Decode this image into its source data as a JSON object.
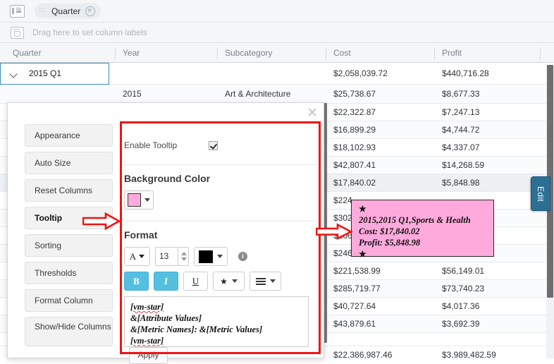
{
  "pivot": {
    "row_labels_icon": "row-labels-icon",
    "chip": {
      "label": "Quarter",
      "drag_handle": "drag-dots-icon",
      "remove": "remove-chip-icon"
    },
    "column_labels_placeholder": "Drag here to set column labels",
    "column_labels_icon": "drop-target-icon"
  },
  "columns": [
    {
      "label": "Quarter"
    },
    {
      "label": "Year"
    },
    {
      "label": "Subcategory"
    },
    {
      "label": "Cost"
    },
    {
      "label": "Profit"
    }
  ],
  "selected_cell": {
    "label": "2015 Q1",
    "expanded": true
  },
  "rows": [
    {
      "quarter": "",
      "year": "",
      "subcategory": "",
      "cost": "$2,058,039.72",
      "profit": "$440,716.28"
    },
    {
      "quarter": "",
      "year": "2015",
      "subcategory": "Art & Architecture",
      "cost": "$25,738.67",
      "profit": "$8,677.33"
    },
    {
      "quarter": "",
      "year": "",
      "subcategory": "",
      "cost": "$22,322.87",
      "profit": "$7,247.13"
    },
    {
      "quarter": "",
      "year": "",
      "subcategory": "",
      "cost": "$16,899.29",
      "profit": "$4,744.72"
    },
    {
      "quarter": "",
      "year": "",
      "subcategory": "",
      "cost": "$18,102.93",
      "profit": "$4,337.07"
    },
    {
      "quarter": "",
      "year": "",
      "subcategory": "",
      "cost": "$42,807.41",
      "profit": "$14,268.59"
    },
    {
      "quarter": "",
      "year": "",
      "subcategory": "",
      "cost": "$17,840.02",
      "profit": "$5,848.98"
    },
    {
      "quarter": "",
      "year": "",
      "subcategory": "",
      "cost": "$224",
      "profit": ""
    },
    {
      "quarter": "",
      "year": "",
      "subcategory": "",
      "cost": "$302",
      "profit": ""
    },
    {
      "quarter": "",
      "year": "",
      "subcategory": "",
      "cost": "$106",
      "profit": ""
    },
    {
      "quarter": "",
      "year": "",
      "subcategory": "",
      "cost": "$246",
      "profit": ""
    },
    {
      "quarter": "",
      "year": "",
      "subcategory": "",
      "cost": "$221,538.99",
      "profit": "$56,149.01"
    },
    {
      "quarter": "",
      "year": "",
      "subcategory": "",
      "cost": "$285,719.77",
      "profit": "$73,740.23"
    },
    {
      "quarter": "",
      "year": "",
      "subcategory": "",
      "cost": "$40,727.64",
      "profit": "$4,017.36"
    },
    {
      "quarter": "",
      "year": "",
      "subcategory": "",
      "cost": "$43,879.61",
      "profit": "$3,692.39"
    },
    {
      "quarter": "",
      "year": "",
      "subcategory": "",
      "cost": "",
      "profit": ""
    },
    {
      "quarter": "",
      "year": "",
      "subcategory": "",
      "cost": "$22,386,987.46",
      "profit": "$3,989,482.59"
    }
  ],
  "edit_tab": {
    "label": "Edit"
  },
  "dialog": {
    "close_label": "close",
    "menu": [
      {
        "label": "Appearance",
        "active": false
      },
      {
        "label": "Auto Size",
        "active": false
      },
      {
        "label": "Reset Columns",
        "active": false
      },
      {
        "label": "Tooltip",
        "active": true
      },
      {
        "label": "Sorting",
        "active": false
      },
      {
        "label": "Thresholds",
        "active": false
      },
      {
        "label": "Format Column",
        "active": false
      },
      {
        "label": "Show/Hide Columns",
        "active": false
      }
    ],
    "enable_tooltip": {
      "label": "Enable Tooltip",
      "checked": true
    },
    "background_color": {
      "title": "Background Color",
      "value": "#FFAADD"
    },
    "format": {
      "title": "Format",
      "font_button": "A",
      "font_size": "13",
      "text_color": "#000000",
      "info_label": "i",
      "bold": {
        "label": "B",
        "active": true
      },
      "italic": {
        "label": "I",
        "active": true
      },
      "underline": {
        "label": "U",
        "active": false
      },
      "symbol": {
        "label": "★",
        "active": false
      },
      "align": {
        "label": "align",
        "active": false
      },
      "text_lines": [
        "[vm-star]",
        "&[Attribute Values]",
        "&[Metric Names]: &[Metric Values]",
        "[vm-star]"
      ]
    },
    "apply_label": "Apply"
  },
  "tooltip_preview": {
    "star_top": "★",
    "line1": "2015,2015 Q1,Sports & Health",
    "line2": "Cost: $17,840.02",
    "line3": "Profit: $5,848.98",
    "star_bottom": "★",
    "background": "#FFAADD"
  },
  "annotations": {
    "highlight_color": "#F01414",
    "arrow_1": "arrow-tooltip-menu",
    "arrow_2": "arrow-tooltip-preview"
  }
}
